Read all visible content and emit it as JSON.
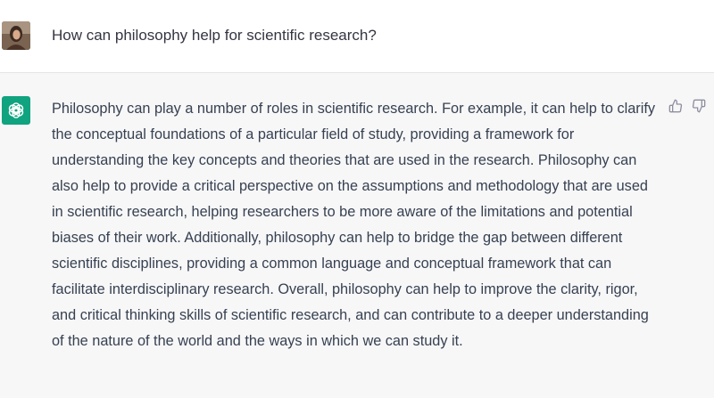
{
  "user_message": {
    "text": "How can philosophy help for scientific research?",
    "avatar_icon": "user-photo-icon"
  },
  "assistant_message": {
    "text": "Philosophy can play a number of roles in scientific research. For example, it can help to clarify the conceptual foundations of a particular field of study, providing a framework for understanding the key concepts and theories that are used in the research. Philosophy can also help to provide a critical perspective on the assumptions and methodology that are used in scientific research, helping researchers to be more aware of the limitations and potential biases of their work. Additionally, philosophy can help to bridge the gap between different scientific disciplines, providing a common language and conceptual framework that can facilitate interdisciplinary research. Overall, philosophy can help to improve the clarity, rigor, and critical thinking skills of scientific research, and can contribute to a deeper understanding of the nature of the world and the ways in which we can study it.",
    "avatar_icon": "openai-logo-icon",
    "feedback_icons": [
      "thumbs-up-icon",
      "thumbs-down-icon"
    ]
  },
  "colors": {
    "assistant_bg": "#f7f7f8",
    "assistant_avatar_bg": "#10a37f",
    "text": "#374151"
  }
}
